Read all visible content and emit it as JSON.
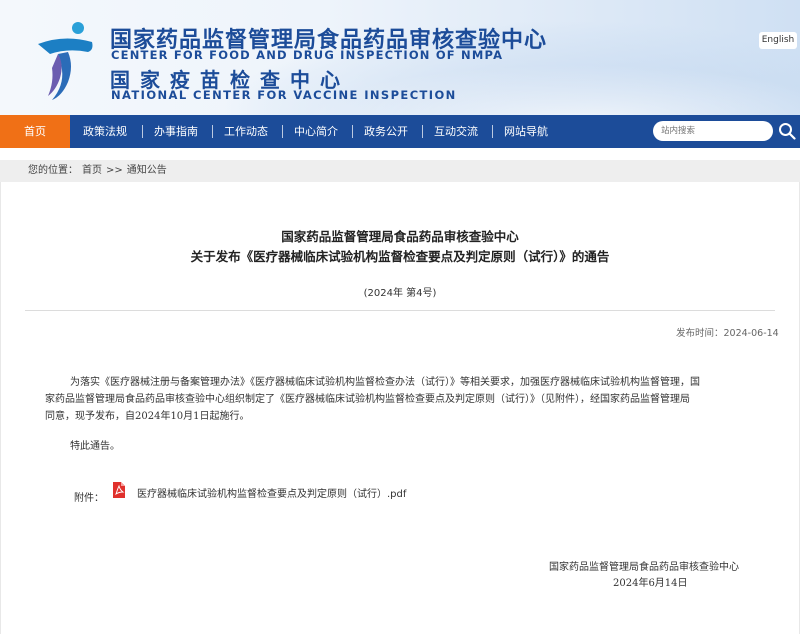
{
  "header": {
    "title_cn_1": "国家药品监督管理局食品药品审核查验中心",
    "title_en_1": "CENTER FOR FOOD AND DRUG INSPECTION OF NMPA",
    "title_cn_2": "国家疫苗检查中心",
    "title_en_2": "NATIONAL CENTER FOR VACCINE INSPECTION",
    "lang_button": "English",
    "brand_color": "#1c4c99"
  },
  "nav": {
    "items": [
      "首页",
      "政策法规",
      "办事指南",
      "工作动态",
      "中心简介",
      "政务公开",
      "互动交流",
      "网站导航"
    ],
    "active_color": "#f07016",
    "search_placeholder": "站内搜索"
  },
  "breadcrumb": {
    "prefix": "您的位置：",
    "home": "首页",
    "separator": ">>",
    "current": "通知公告"
  },
  "article": {
    "title_line_1": "国家药品监督管理局食品药品审核查验中心",
    "title_line_2": "关于发布《医疗器械临床试验机构监督检查要点及判定原则（试行）》的通告",
    "doc_number": "(2024年 第4号)",
    "publish_date": "发布时间：2024-06-14",
    "body_lines": [
      "为落实《医疗器械注册与备案管理办法》《医疗器械临床试验机构监督检查办法（试行）》等相关要求，加强医疗器械临床试验机构监督管理，国",
      "家药品监督管理局食品药品审核查验中心组织制定了《医疗器械临床试验机构监督检查要点及判定原则（试行）》（见附件），经国家药品监督管理局",
      "同意，现予发布，自2024年10月1日起施行。"
    ],
    "closing": "特此通告。",
    "attachment_label": "附件：",
    "attachment_file": "医疗器械临床试验机构监督检查要点及判定原则（试行）.pdf",
    "sign_org": "国家药品监督管理局食品药品审核查验中心",
    "sign_date": "2024年6月14日"
  }
}
